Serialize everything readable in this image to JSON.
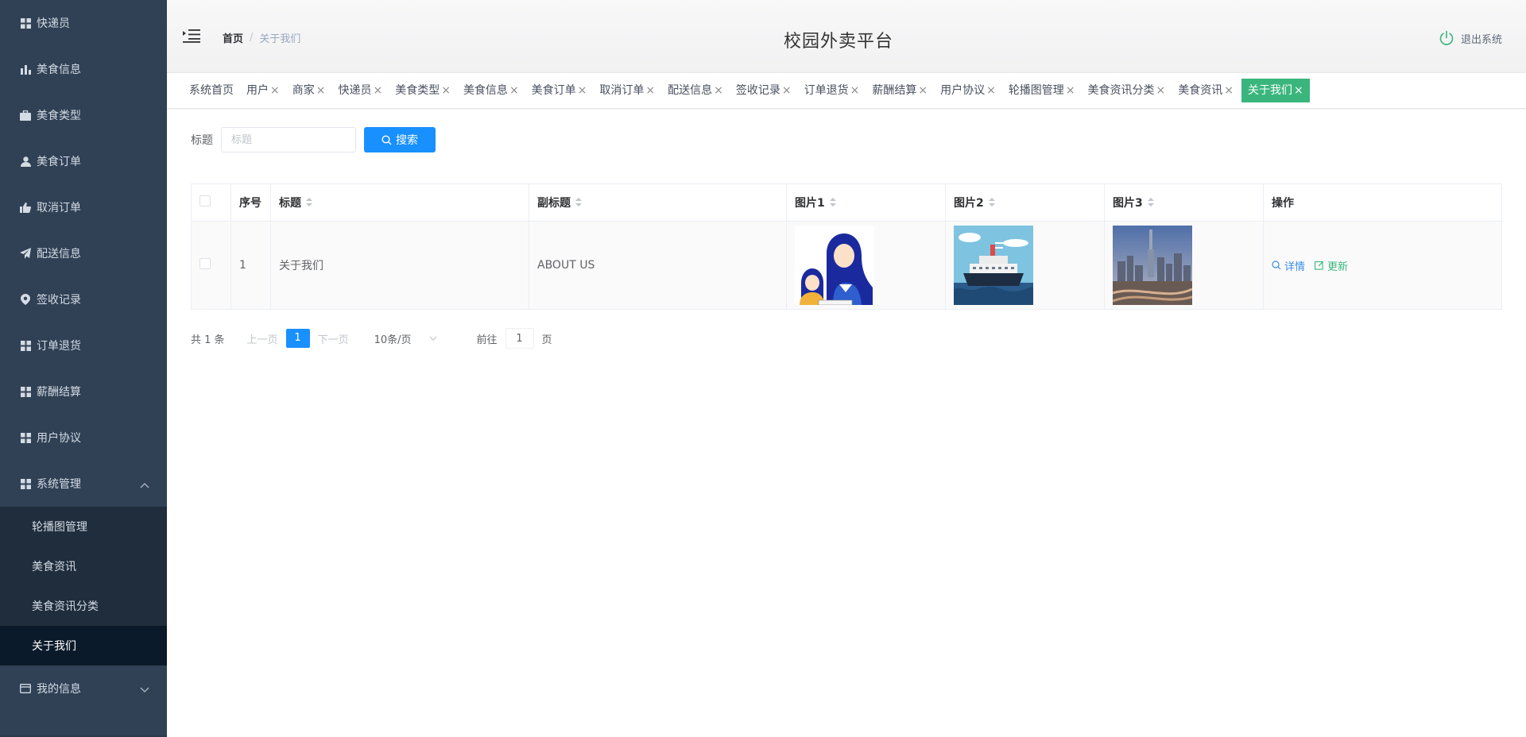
{
  "sidebar": {
    "items": [
      {
        "label": "快递员",
        "icon": "grid-icon"
      },
      {
        "label": "美食信息",
        "icon": "bar-chart-icon"
      },
      {
        "label": "美食类型",
        "icon": "briefcase-icon"
      },
      {
        "label": "美食订单",
        "icon": "user-icon"
      },
      {
        "label": "取消订单",
        "icon": "thumb-icon"
      },
      {
        "label": "配送信息",
        "icon": "paper-plane-icon"
      },
      {
        "label": "签收记录",
        "icon": "pin-icon"
      },
      {
        "label": "订单退货",
        "icon": "grid-icon"
      },
      {
        "label": "薪酬结算",
        "icon": "grid-icon"
      },
      {
        "label": "用户协议",
        "icon": "grid-icon"
      }
    ],
    "system_menu": {
      "label": "系统管理",
      "icon": "grid-icon"
    },
    "system_children": [
      "轮播图管理",
      "美食资讯",
      "美食资讯分类",
      "关于我们"
    ],
    "my_info": {
      "label": "我的信息",
      "icon": "card-icon"
    }
  },
  "header": {
    "breadcrumb_home": "首页",
    "breadcrumb_sep": "/",
    "breadcrumb_current": "关于我们",
    "title": "校园外卖平台",
    "logout": "退出系统"
  },
  "tags": [
    "系统首页",
    "用户",
    "商家",
    "快递员",
    "美食类型",
    "美食信息",
    "美食订单",
    "取消订单",
    "配送信息",
    "签收记录",
    "订单退货",
    "薪酬结算",
    "用户协议",
    "轮播图管理",
    "美食资讯分类",
    "美食资讯",
    "关于我们"
  ],
  "tag_close": "×",
  "search": {
    "label": "标题",
    "placeholder": "标题",
    "button": "搜索"
  },
  "table": {
    "headers": {
      "index": "序号",
      "title": "标题",
      "subtitle": "副标题",
      "img1": "图片1",
      "img2": "图片2",
      "img3": "图片3",
      "ops": "操作"
    },
    "rows": [
      {
        "index": "1",
        "title": "关于我们",
        "subtitle": "ABOUT US",
        "detail": "详情",
        "update": "更新"
      }
    ]
  },
  "pagination": {
    "total": "共 1 条",
    "prev": "上一页",
    "current": "1",
    "next": "下一页",
    "page_size": "10条/页",
    "goto_label": "前往",
    "goto_value": "1",
    "goto_suffix": "页"
  },
  "colors": {
    "sidebar": "#304156",
    "active_tag": "#3ab67d",
    "primary": "#1890ff"
  }
}
